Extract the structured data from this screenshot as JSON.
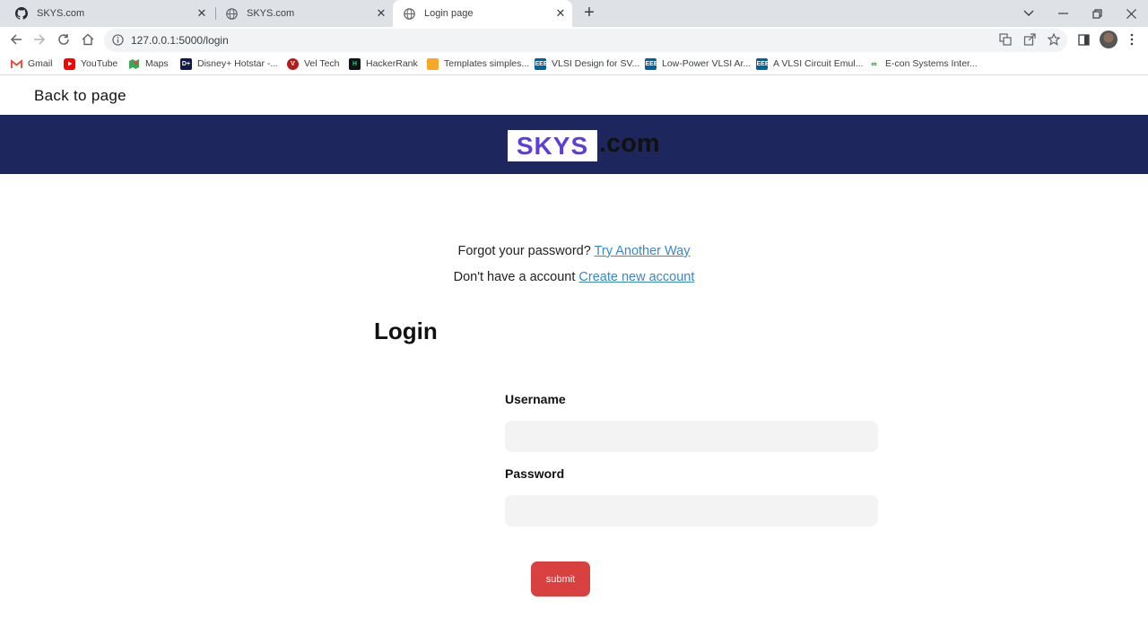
{
  "browser": {
    "tabs": [
      {
        "title": "SKYS.com",
        "icon": "github-icon"
      },
      {
        "title": "SKYS.com",
        "icon": "globe-icon"
      },
      {
        "title": "Login page",
        "icon": "globe-icon",
        "active": true
      }
    ],
    "url": "127.0.0.1:5000/login",
    "bookmarks": [
      {
        "label": "Gmail",
        "icon": "gmail-icon"
      },
      {
        "label": "YouTube",
        "icon": "youtube-icon"
      },
      {
        "label": "Maps",
        "icon": "maps-icon"
      },
      {
        "label": "Disney+ Hotstar -...",
        "icon": "hotstar-icon"
      },
      {
        "label": "Vel Tech",
        "icon": "veltech-icon"
      },
      {
        "label": "HackerRank",
        "icon": "hackerrank-icon"
      },
      {
        "label": "Templates simples...",
        "icon": "templates-icon"
      },
      {
        "label": "VLSI Design for SV...",
        "icon": "ieee-icon"
      },
      {
        "label": "Low-Power VLSI Ar...",
        "icon": "ieee-icon"
      },
      {
        "label": "A VLSI Circuit Emul...",
        "icon": "ieee-icon"
      },
      {
        "label": "E-con Systems Inter...",
        "icon": "econ-icon"
      }
    ]
  },
  "page": {
    "back_link": "Back to page",
    "brand": {
      "name": "SKYS",
      "suffix": ".com",
      "bar_color": "#1d275d",
      "name_color": "#5b3fd8"
    },
    "forgot_text": "Forgot your password?",
    "forgot_link": "Try Another Way",
    "signup_text": "Don't have a account",
    "signup_link": "Create new account",
    "heading": "Login",
    "username_label": "Username",
    "password_label": "Password",
    "submit_label": "submit",
    "submit_color": "#d94040"
  }
}
